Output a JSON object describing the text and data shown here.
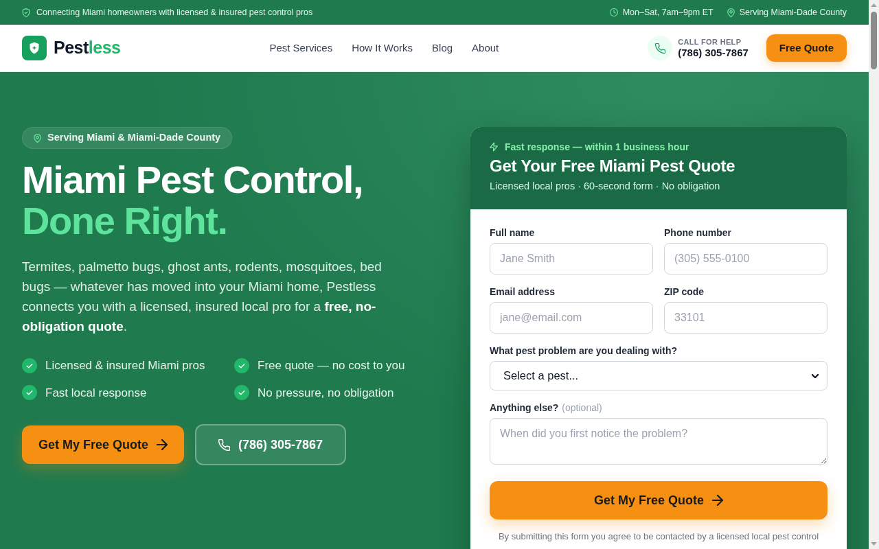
{
  "top_bar": {
    "tagline": "Connecting Miami homeowners with licensed & insured pest control pros",
    "hours": "Mon–Sat, 7am–9pm ET",
    "area": "Serving Miami-Dade County"
  },
  "header": {
    "brand": {
      "name_start": "Pest",
      "name_end": "less"
    },
    "nav": [
      "Pest Services",
      "How It Works",
      "Blog",
      "About"
    ],
    "call": {
      "label": "CALL FOR HELP",
      "phone": "(786) 305-7867"
    },
    "cta": "Free Quote"
  },
  "hero": {
    "badge": "Serving Miami & Miami-Dade County",
    "headline": "Miami Pest Control,",
    "headline_accent": "Done Right.",
    "intro": "Termites, palmetto bugs, ghost ants, rodents, mosquitoes, bed bugs — whatever has moved into your Miami home, Pestless connects you with a licensed, insured local pro for a **free, no-obligation quote**.",
    "benefits": [
      "Licensed & insured Miami pros",
      "Free quote — no cost to you",
      "Fast local response",
      "No pressure, no obligation"
    ],
    "primary_button": "Get My Free Quote",
    "phone_button": "(786) 305-7867"
  },
  "quote_form": {
    "notice": "Fast response — within 1 business hour",
    "title": "Get Your Free Miami Pest Quote",
    "subtitle": "Licensed local pros · 60-second form · No obligation",
    "fields": [
      {
        "kind": "text",
        "label": "Full name",
        "placeholder": "Jane Smith"
      },
      {
        "kind": "text",
        "label": "Phone number",
        "placeholder": "(305) 555-0100"
      },
      {
        "kind": "text",
        "label": "Email address",
        "placeholder": "jane@email.com"
      },
      {
        "kind": "text",
        "label": "ZIP code",
        "placeholder": "33101"
      },
      {
        "kind": "select",
        "label": "What pest problem are you dealing with?",
        "value": "Select a pest..."
      },
      {
        "kind": "textarea",
        "label": "Anything else?",
        "hint": "(optional)",
        "placeholder": "When did you first notice the problem?"
      }
    ],
    "submit": "Get My Free Quote",
    "disclaimer": "By submitting this form you agree to be contacted by a licensed local pest control"
  }
}
